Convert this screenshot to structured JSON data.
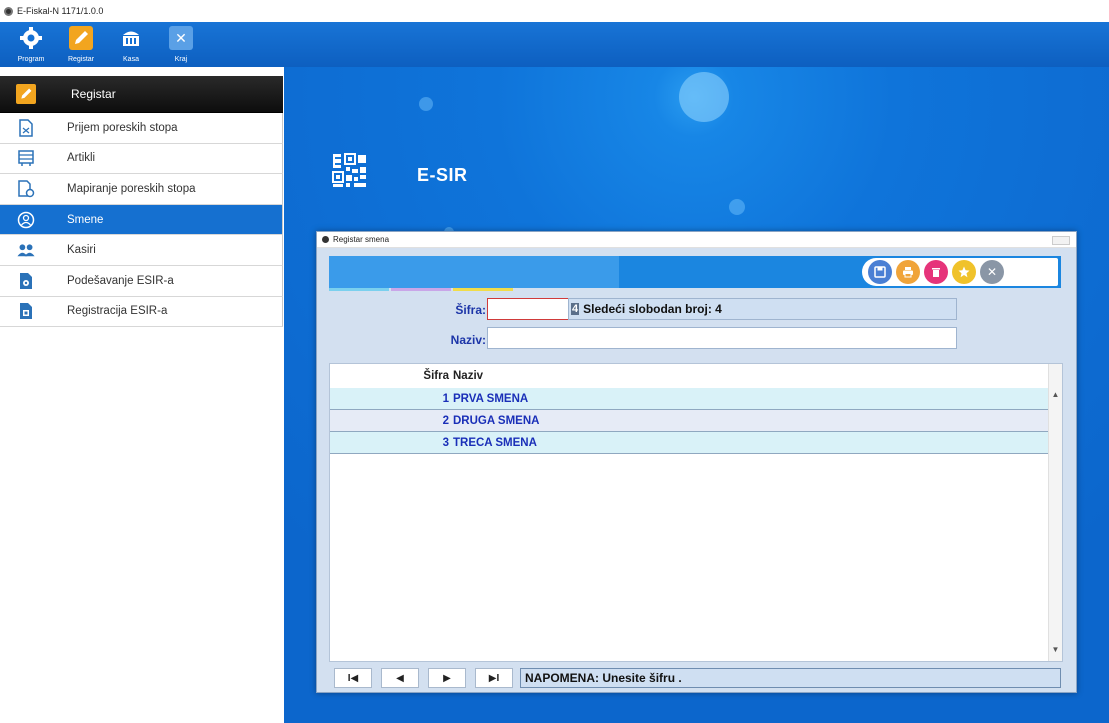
{
  "window": {
    "title": "E-Fiskal-N 1171/1.0.0"
  },
  "toolbar": {
    "buttons": [
      {
        "label": "Program",
        "icon": "gear-icon"
      },
      {
        "label": "Registar",
        "icon": "pencil-icon"
      },
      {
        "label": "Kasa",
        "icon": "cash-register-icon"
      },
      {
        "label": "Kraj",
        "icon": "close-icon"
      }
    ]
  },
  "sidebar": {
    "header": {
      "label": "Registar",
      "icon": "pencil-icon"
    },
    "items": [
      {
        "label": "Prijem poreskih stopa",
        "icon": "document-icon"
      },
      {
        "label": "Artikli",
        "icon": "list-icon"
      },
      {
        "label": "Mapiranje poreskih stopa",
        "icon": "mapping-icon"
      },
      {
        "label": "Smene",
        "icon": "shift-icon",
        "active": true
      },
      {
        "label": "Kasiri",
        "icon": "users-icon"
      },
      {
        "label": "Podešavanje ESIR-a",
        "icon": "settings-doc-icon"
      },
      {
        "label": "Registracija ESIR-a",
        "icon": "register-doc-icon"
      }
    ]
  },
  "main": {
    "app_name": "E-SIR"
  },
  "dialog": {
    "title": "Registar smena",
    "action_buttons": [
      {
        "icon": "save-icon",
        "color": "#4a7fd4"
      },
      {
        "icon": "print-icon",
        "color": "#f0a43a"
      },
      {
        "icon": "delete-icon",
        "color": "#e6347a"
      },
      {
        "icon": "star-icon",
        "color": "#f0c22a"
      },
      {
        "icon": "close-icon",
        "color": "#8a96a6"
      }
    ],
    "form": {
      "sifra_label": "Šifra:",
      "sifra_value": "",
      "next_free_number": "4",
      "next_free_text": "Sledeći slobodan broj: 4",
      "naziv_label": "Naziv:",
      "naziv_value": ""
    },
    "grid": {
      "columns": [
        "Šifra",
        "Naziv"
      ],
      "rows": [
        {
          "sifra": "1",
          "naziv": "PRVA SMENA"
        },
        {
          "sifra": "2",
          "naziv": "DRUGA SMENA"
        },
        {
          "sifra": "3",
          "naziv": "TRECA SMENA"
        }
      ]
    },
    "navigator": {
      "first": "I◀",
      "prev": "◀",
      "next": "▶",
      "last": "▶I",
      "note": "NAPOMENA: Unesite šifru ."
    }
  },
  "colors": {
    "toolbar": "#1470d4",
    "accent": "#f2a51f",
    "active_item": "#1570d0",
    "grid_text": "#1a2fb8",
    "label_text": "#1c35a8"
  }
}
